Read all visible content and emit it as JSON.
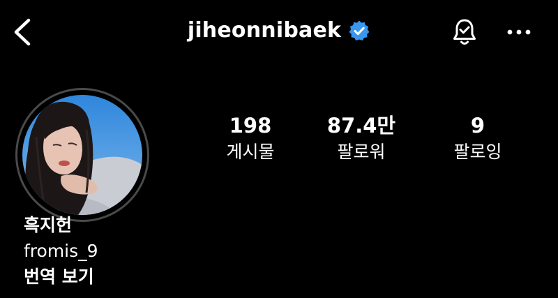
{
  "header": {
    "username": "jiheonnibaek",
    "verified": true,
    "icons": {
      "back": "chevron-left-icon",
      "verified": "verified-badge-icon",
      "notifications": "bell-check-icon",
      "more": "more-horizontal-icon"
    },
    "colors": {
      "verified_badge": "#3897f0"
    }
  },
  "profile": {
    "avatar_description": "profile-photo",
    "stats": [
      {
        "value": "198",
        "label": "게시물"
      },
      {
        "value": "87.4만",
        "label": "팔로워"
      },
      {
        "value": "9",
        "label": "팔로잉"
      }
    ]
  },
  "bio": {
    "name": "흑지헌",
    "text": "fromis_9",
    "translate_label": "번역 보기"
  },
  "theme": {
    "background": "#000000",
    "text": "#ffffff",
    "avatar_ring": "#4a4a4a"
  }
}
